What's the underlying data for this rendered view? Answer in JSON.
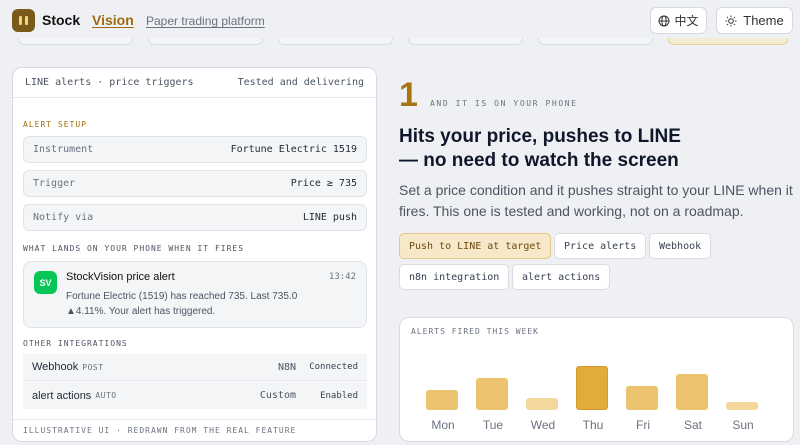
{
  "header": {
    "brand_primary": "Stock",
    "brand_accent": "Vision",
    "tagline": "Paper trading platform",
    "language_label": "中文",
    "theme_label": "Theme"
  },
  "alert_card": {
    "title": "LINE alerts · price triggers",
    "status": "Tested and delivering",
    "setup_label": "Alert setup",
    "fields": [
      {
        "key": "Instrument",
        "value": "Fortune Electric 1519"
      },
      {
        "key": "Trigger",
        "value": "Price ≥ 735"
      },
      {
        "key": "Notify via",
        "value": "LINE push"
      }
    ],
    "phone_label": "What lands on your phone when it fires",
    "notification": {
      "icon_text": "SV",
      "title": "StockVision price alert",
      "time": "13:42",
      "line1": "Fortune Electric (1519) has reached 735. Last 735.0",
      "line2": "▲4.11%. Your alert has triggered."
    },
    "integrations_label": "Other integrations",
    "integrations": [
      {
        "name": "Webhook",
        "tag": "POST",
        "detail": "N8N",
        "status": "Connected"
      },
      {
        "name": "alert actions",
        "tag": "AUTO",
        "detail": "Custom",
        "status": "Enabled"
      }
    ],
    "footer": "Illustrative UI · redrawn from the real feature"
  },
  "feature": {
    "number": "1",
    "kicker": "And it is on your phone",
    "headline_line1": "Hits your price, pushes to LINE",
    "headline_line2": "— no need to watch the screen",
    "description": "Set a price condition and it pushes straight to your LINE when it fires. This one is tested and working, not on a roadmap.",
    "chips": [
      "Push to LINE at target",
      "Price alerts",
      "Webhook",
      "n8n integration",
      "alert actions"
    ]
  },
  "colors": {
    "accent": "#a77412",
    "chip_active_bg": "#f6e8c8",
    "line_green": "#06c755",
    "bar_light": "#f3d79b",
    "bar_mid": "#ecc46f",
    "bar_dark": "#e3aa3c"
  },
  "chart_data": {
    "type": "bar",
    "title": "Alerts fired this week",
    "categories": [
      "Mon",
      "Tue",
      "Wed",
      "Thu",
      "Fri",
      "Sat",
      "Sun"
    ],
    "values": [
      5,
      8,
      3,
      11,
      6,
      9,
      2
    ],
    "ylim": [
      0,
      11
    ],
    "grid": false,
    "xlabel": "",
    "ylabel": ""
  }
}
